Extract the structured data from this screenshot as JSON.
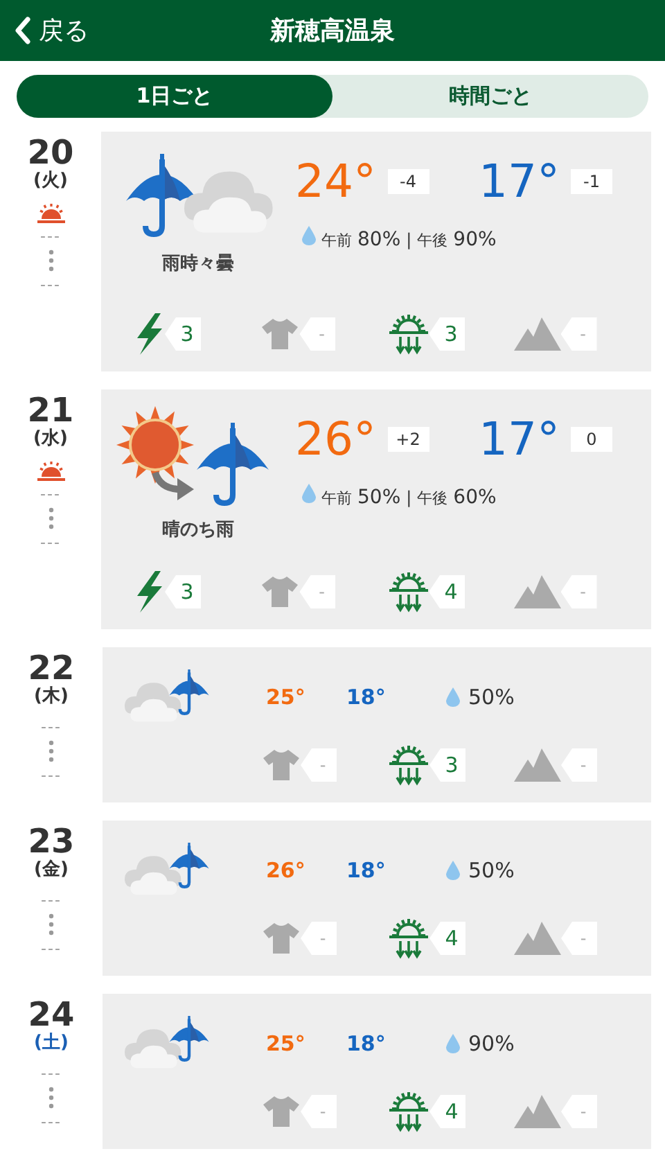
{
  "header": {
    "back": "戻る",
    "title": "新穂高温泉"
  },
  "tabs": [
    {
      "label": "1日ごと",
      "selected": true
    },
    {
      "label": "時間ごと",
      "selected": false
    }
  ],
  "days": [
    {
      "kind": "detailed",
      "date": "20",
      "weekday": "(火)",
      "color": "#333333",
      "warning": true,
      "dash_top": "---",
      "dash_bottom": "---",
      "weather": {
        "kind": "rain_cloudy"
      },
      "condition": "雨時々曇",
      "high": "24°",
      "high_diff": "-4",
      "low": "17°",
      "low_diff": "-1",
      "separator": "|",
      "rain": [
        {
          "label": "午前",
          "value": "80%"
        },
        {
          "label": "午後",
          "value": "90%"
        }
      ],
      "indices": [
        {
          "kind": "lightning",
          "active": true,
          "value": "3"
        },
        {
          "kind": "shirt",
          "active": false,
          "value": "-"
        },
        {
          "kind": "rain_sun",
          "active": true,
          "value": "3"
        },
        {
          "kind": "mountain",
          "active": false,
          "value": "-"
        }
      ]
    },
    {
      "kind": "detailed",
      "date": "21",
      "weekday": "(水)",
      "color": "#333333",
      "warning": true,
      "dash_top": "---",
      "dash_bottom": "---",
      "weather": {
        "kind": "sun_then_rain"
      },
      "condition": "晴のち雨",
      "high": "26°",
      "high_diff": "+2",
      "low": "17°",
      "low_diff": "0",
      "separator": "|",
      "rain": [
        {
          "label": "午前",
          "value": "50%"
        },
        {
          "label": "午後",
          "value": "60%"
        }
      ],
      "indices": [
        {
          "kind": "lightning",
          "active": true,
          "value": "3"
        },
        {
          "kind": "shirt",
          "active": false,
          "value": "-"
        },
        {
          "kind": "rain_sun",
          "active": true,
          "value": "4"
        },
        {
          "kind": "mountain",
          "active": false,
          "value": "-"
        }
      ]
    },
    {
      "kind": "compact",
      "date": "22",
      "weekday": "(木)",
      "color": "#333333",
      "warning": false,
      "dash_top": "---",
      "dash_bottom": "---",
      "weather": {
        "kind": "cloud_rain"
      },
      "high": "25°",
      "low": "18°",
      "rain_chance": "50%",
      "indices": [
        {
          "kind": "shirt",
          "active": false,
          "value": "-"
        },
        {
          "kind": "rain_sun",
          "active": true,
          "value": "3"
        },
        {
          "kind": "mountain",
          "active": false,
          "value": "-"
        }
      ]
    },
    {
      "kind": "compact",
      "date": "23",
      "weekday": "(金)",
      "color": "#333333",
      "warning": false,
      "dash_top": "---",
      "dash_bottom": "---",
      "weather": {
        "kind": "cloud_rain"
      },
      "high": "26°",
      "low": "18°",
      "rain_chance": "50%",
      "indices": [
        {
          "kind": "shirt",
          "active": false,
          "value": "-"
        },
        {
          "kind": "rain_sun",
          "active": true,
          "value": "4"
        },
        {
          "kind": "mountain",
          "active": false,
          "value": "-"
        }
      ]
    },
    {
      "kind": "compact",
      "date": "24",
      "weekday": "(土)",
      "color": "#1a5fb4",
      "warning": false,
      "dash_top": "---",
      "dash_bottom": "---",
      "weather": {
        "kind": "cloud_rain"
      },
      "high": "25°",
      "low": "18°",
      "rain_chance": "90%",
      "indices": [
        {
          "kind": "shirt",
          "active": false,
          "value": "-"
        },
        {
          "kind": "rain_sun",
          "active": true,
          "value": "4"
        },
        {
          "kind": "mountain",
          "active": false,
          "value": "-"
        }
      ]
    }
  ]
}
